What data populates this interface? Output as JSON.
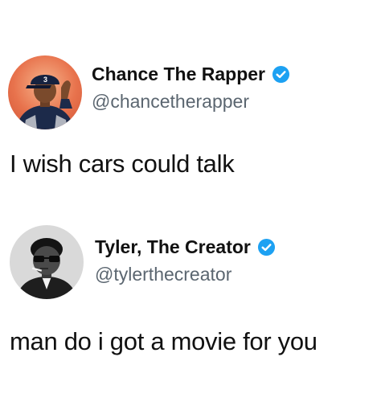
{
  "tweets": [
    {
      "display_name": "Chance The Rapper",
      "handle": "@chancetherapper",
      "text": "I wish cars could talk",
      "verified": true,
      "avatar_cap_number": "3"
    },
    {
      "display_name": "Tyler, The Creator",
      "handle": "@tylerthecreator",
      "text": "man do i got a movie for you",
      "verified": true
    }
  ],
  "colors": {
    "verified_badge": "#1da1f2",
    "handle": "#5b6670",
    "text": "#111111",
    "avatar1_bg": "#e8734d"
  }
}
